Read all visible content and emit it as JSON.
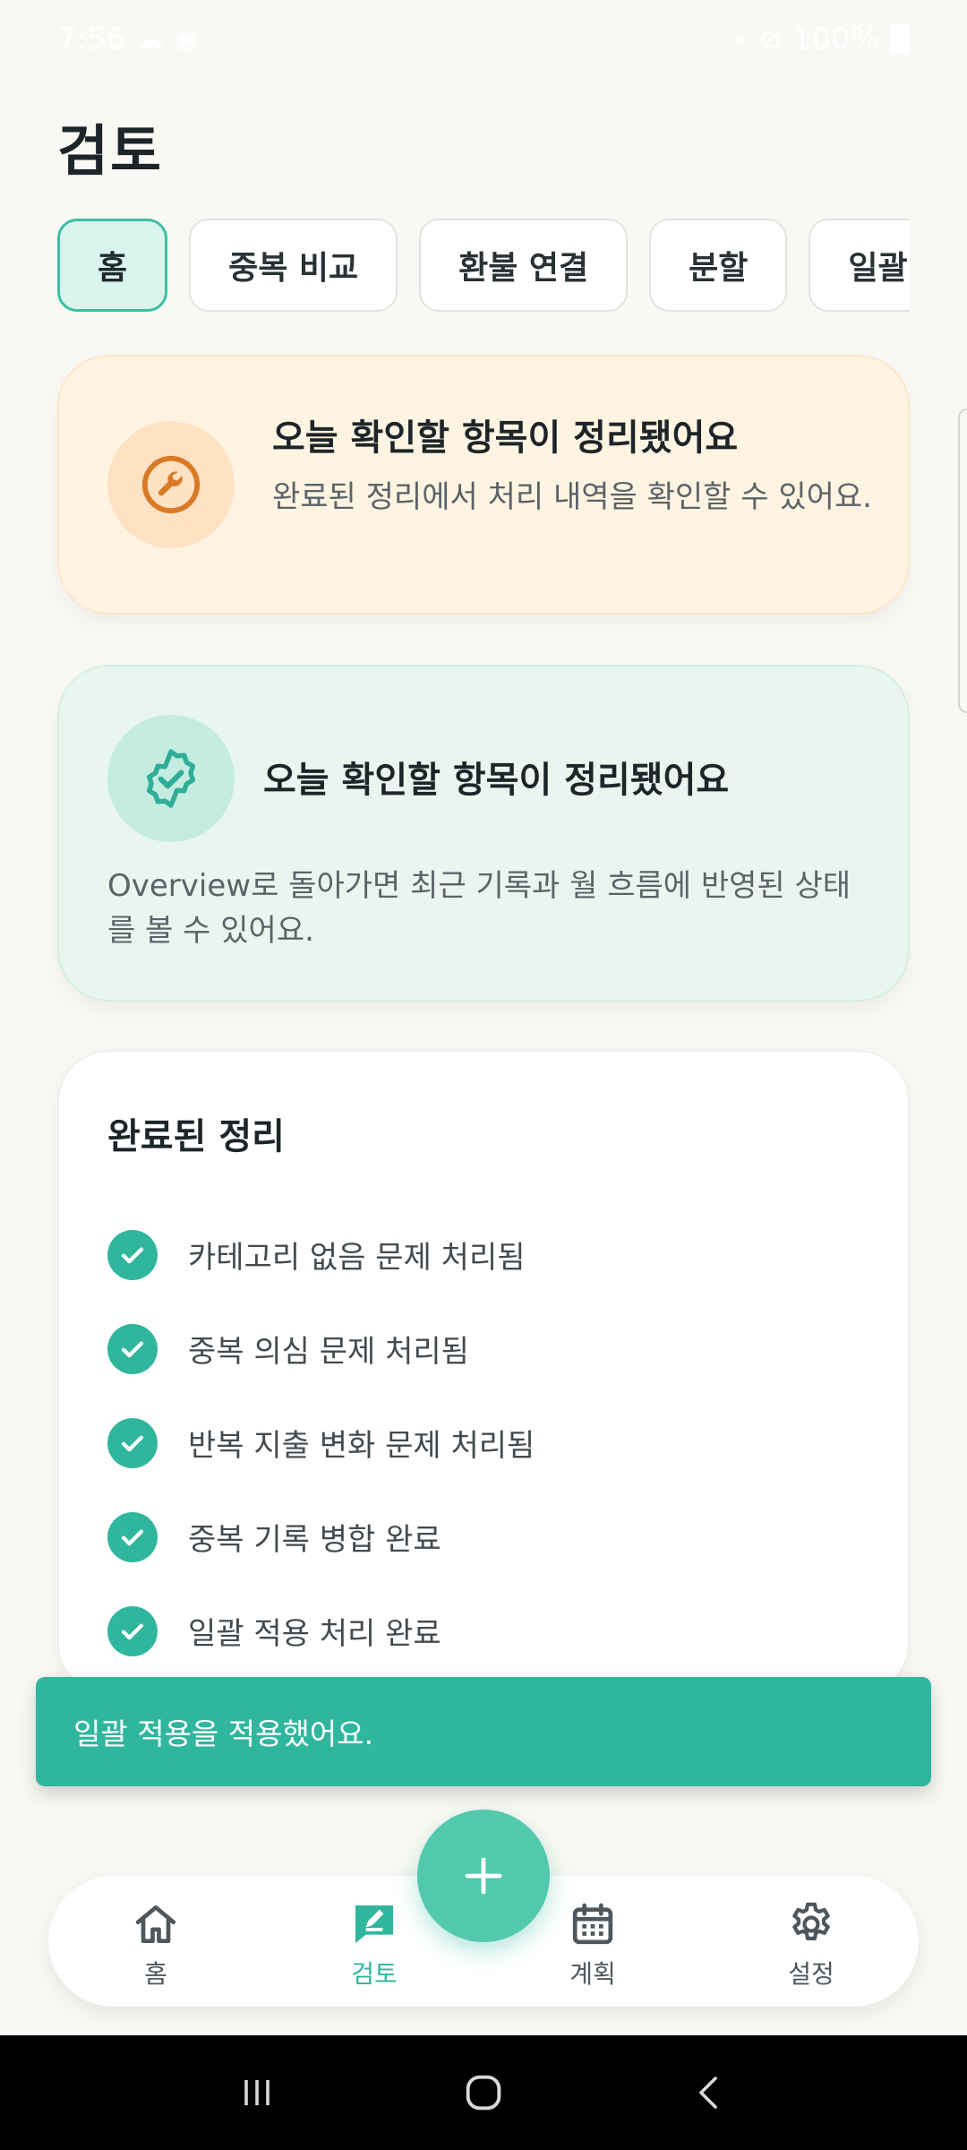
{
  "status_bar": {
    "time": "7:56",
    "battery": "100%"
  },
  "page": {
    "title": "검토"
  },
  "tabs": [
    {
      "label": "홈",
      "active": true
    },
    {
      "label": "중복 비교",
      "active": false
    },
    {
      "label": "환불 연결",
      "active": false
    },
    {
      "label": "분할",
      "active": false
    },
    {
      "label": "일괄 적용",
      "active": false
    }
  ],
  "notice_card": {
    "icon": "wrench-icon",
    "title": "오늘 확인할 항목이 정리됐어요",
    "description": "완료된 정리에서 처리 내역을 확인할 수 있어요."
  },
  "success_card": {
    "icon": "verified-badge-icon",
    "title": "오늘 확인할 항목이 정리됐어요",
    "description": "Overview로 돌아가면 최근 기록과 월 흐름에 반영된 상태를 볼 수 있어요."
  },
  "completed": {
    "title": "완료된 정리",
    "items": [
      {
        "label": "카테고리 없음 문제 처리됨"
      },
      {
        "label": "중복 의심 문제 처리됨"
      },
      {
        "label": "반복 지출 변화 문제 처리됨"
      },
      {
        "label": "중복 기록 병합 완료"
      },
      {
        "label": "일괄 적용 처리 완료"
      }
    ]
  },
  "toast": {
    "message": "일괄 적용을 적용했어요."
  },
  "bottom_nav": {
    "items": [
      {
        "label": "홈",
        "icon": "home-icon"
      },
      {
        "label": "검토",
        "icon": "review-edit-icon",
        "active": true
      },
      {
        "label": "계획",
        "icon": "calendar-icon"
      },
      {
        "label": "설정",
        "icon": "gear-icon"
      }
    ]
  },
  "colors": {
    "accent": "#31b69e",
    "warning_bg": "#fff4e2",
    "warning_icon": "#d97a26",
    "success_bg": "#e8f6ef"
  }
}
